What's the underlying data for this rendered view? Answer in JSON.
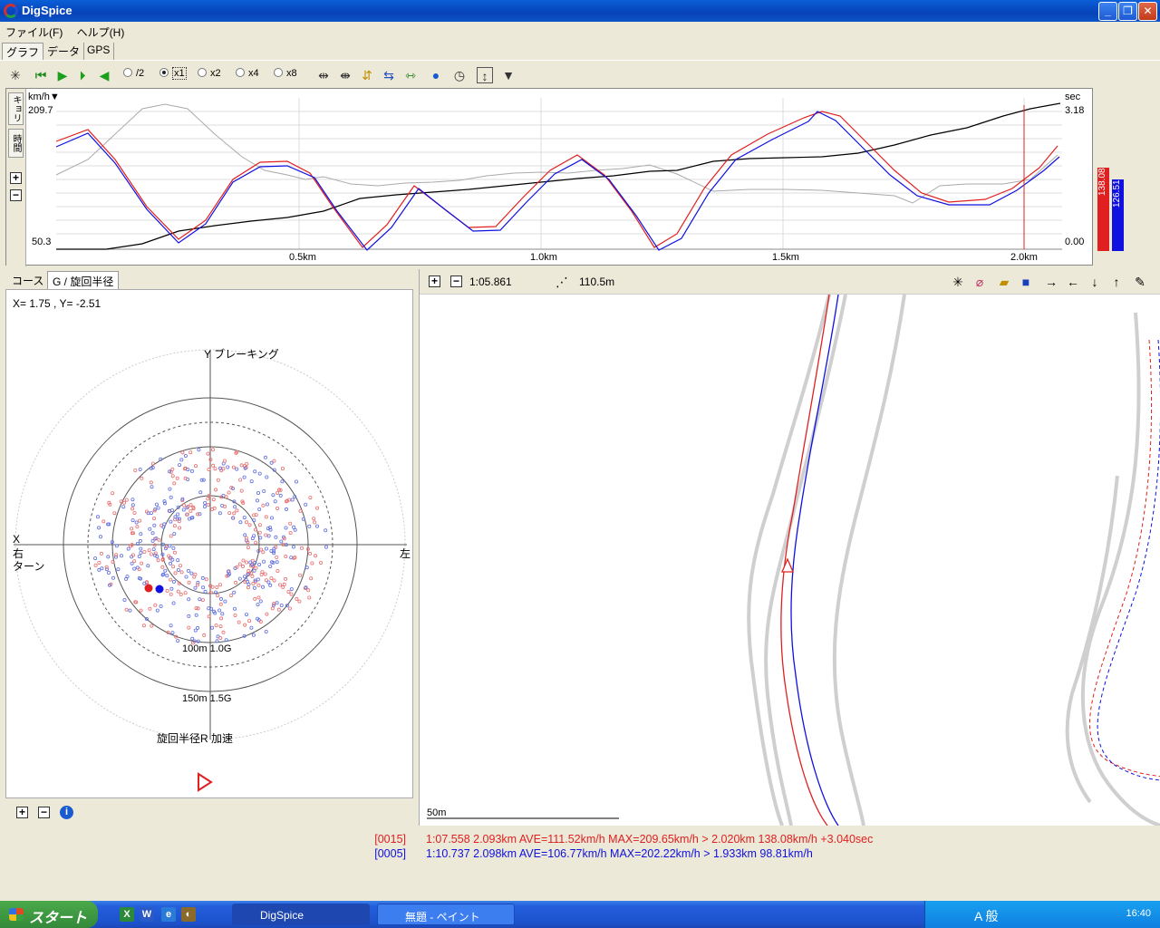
{
  "window": {
    "title": "DigSpice"
  },
  "menu": [
    "ファイル(F)",
    "ヘルプ(H)"
  ],
  "tabs": [
    "グラフ",
    "データ",
    "GPS"
  ],
  "toolbar": {
    "speeds": [
      "/2",
      "x1",
      "x2",
      "x4",
      "x8"
    ],
    "selected_speed": "x1"
  },
  "graph": {
    "left_unit": "km/h▼",
    "right_unit": "sec",
    "left_max": "209.7",
    "left_min": "50.3",
    "right_max": "3.18",
    "right_min": "0.00",
    "side_tabs": [
      "キョリ",
      "時間"
    ],
    "x_ticks": [
      "0.5km",
      "1.0km",
      "1.5km",
      "2.0km"
    ],
    "bar_red": "138.08",
    "bar_blue": "126.51",
    "colors": {
      "red": "#e02020",
      "blue": "#1010e0",
      "gray": "#aaaaaa"
    }
  },
  "gpanel": {
    "tabs": [
      "コース",
      "G / 旋回半径"
    ],
    "coords": "X=  1.75  , Y= -2.51",
    "label_top": "Y ブレーキング",
    "label_x": "X",
    "label_right": "右",
    "label_turn": "ターン",
    "label_left": "左",
    "ring1": "100m  1.0G",
    "ring2": "150m  1.5G",
    "label_bottom": "旋回半径R  加速"
  },
  "map": {
    "time": "1:05.861",
    "distance": "110.5m",
    "scale": "50m"
  },
  "laps": [
    {
      "id": "[0015]",
      "text": "1:07.558  2.093km  AVE=111.52km/h  MAX=209.65km/h  >  2.020km  138.08km/h  +3.040sec",
      "color": "#e02020"
    },
    {
      "id": "[0005]",
      "text": "1:10.737  2.098km  AVE=106.77km/h  MAX=202.22km/h  >  1.933km  98.81km/h",
      "color": "#1010e0"
    }
  ],
  "taskbar": {
    "start": "スタート",
    "tasks": [
      "DigSpice",
      "無題 - ペイント"
    ],
    "ime": "A 般",
    "clock": "16:40"
  }
}
